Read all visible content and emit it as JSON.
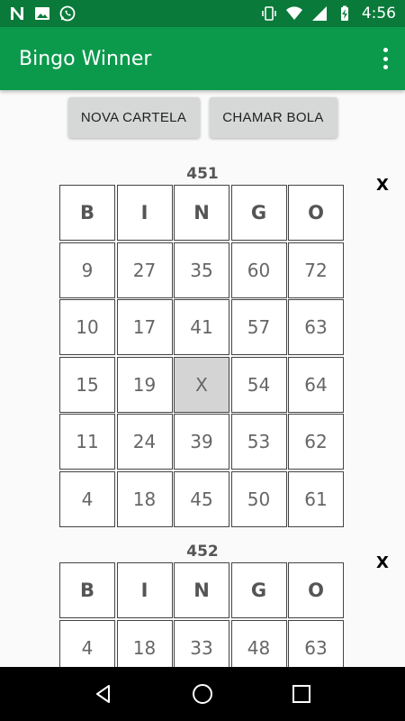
{
  "status_bar": {
    "time": "4:56",
    "left_icons": [
      "n-icon",
      "image-icon",
      "whatsapp-icon"
    ],
    "right_icons": [
      "vibrate-icon",
      "wifi-icon",
      "signal-icon",
      "battery-charging-icon"
    ]
  },
  "app_bar": {
    "title": "Bingo Winner",
    "overflow_icon": "more-vert-icon"
  },
  "actions": {
    "new_card_label": "NOVA CARTELA",
    "call_ball_label": "CHAMAR BOLA"
  },
  "cards": [
    {
      "number": "451",
      "remove_label": "X",
      "headers": [
        "B",
        "I",
        "N",
        "G",
        "O"
      ],
      "rows": [
        [
          "9",
          "27",
          "35",
          "60",
          "72"
        ],
        [
          "10",
          "17",
          "41",
          "57",
          "63"
        ],
        [
          "15",
          "19",
          "X",
          "54",
          "64"
        ],
        [
          "11",
          "24",
          "39",
          "53",
          "62"
        ],
        [
          "4",
          "18",
          "45",
          "50",
          "61"
        ]
      ]
    },
    {
      "number": "452",
      "remove_label": "X",
      "headers": [
        "B",
        "I",
        "N",
        "G",
        "O"
      ],
      "rows": [
        [
          "4",
          "18",
          "33",
          "48",
          "63"
        ]
      ]
    }
  ],
  "nav_bar": {
    "icons": [
      "back-icon",
      "home-icon",
      "recents-icon"
    ]
  },
  "colors": {
    "status_bar": "#0a7a3a",
    "app_bar": "#0b9a4c",
    "marked_cell": "#d4d4d4"
  }
}
